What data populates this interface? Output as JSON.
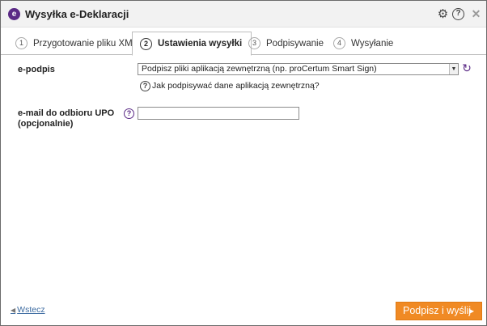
{
  "window": {
    "title": "Wysyłka e-Deklaracji",
    "logo_letter": "e",
    "icons": [
      "gear-icon",
      "help-icon",
      "close-icon"
    ]
  },
  "tabs": [
    {
      "num": "1",
      "label": "Przygotowanie pliku XML",
      "active": false
    },
    {
      "num": "2",
      "label": "Ustawienia wysyłki",
      "active": true
    },
    {
      "num": "3",
      "label": "Podpisywanie",
      "active": false
    },
    {
      "num": "4",
      "label": "Wysyłanie",
      "active": false
    }
  ],
  "form": {
    "epodpis_label": "e-podpis",
    "epodpis_value": "Podpisz pliki aplikacją zewnętrzną (np. proCertum Smart Sign)",
    "help_link": "Jak podpisywać dane aplikacją zewnętrzną?",
    "email_label_line1": "e-mail do odbioru UPO",
    "email_label_line2": "(opcjonalnie)",
    "email_value": ""
  },
  "footer": {
    "back_label": "Wstecz",
    "submit_label": "Podpisz i wyślij"
  },
  "colors": {
    "accent": "#f08a24",
    "brand": "#5b2a86",
    "link": "#3b6aa0"
  }
}
